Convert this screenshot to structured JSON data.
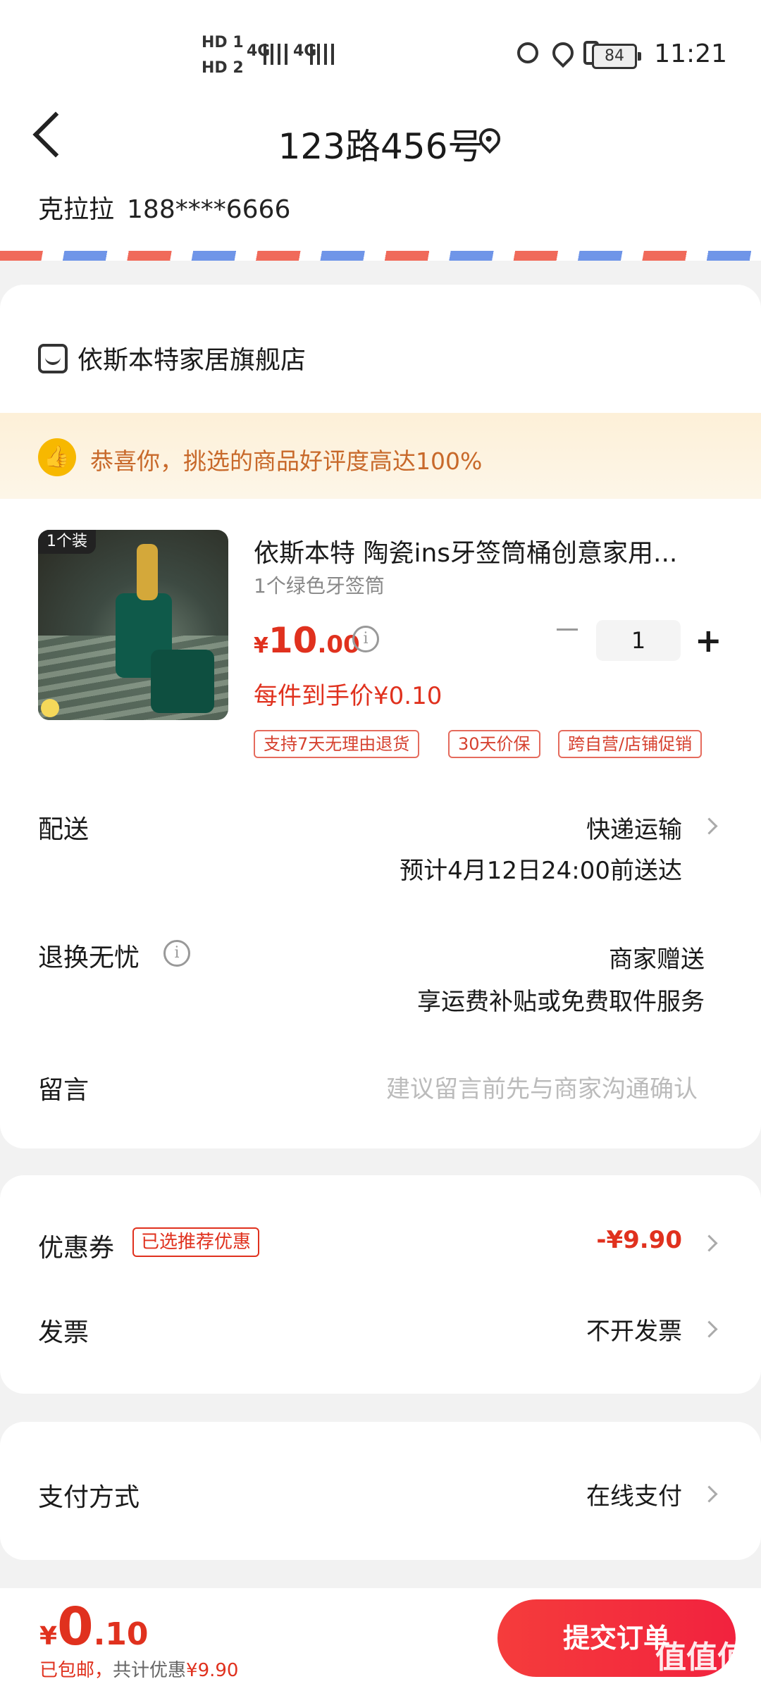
{
  "status_bar": {
    "hd1": "HD 1",
    "hd2": "HD 2",
    "net1": "4G",
    "net2": "4G",
    "battery": "84",
    "time": "11:21"
  },
  "address": {
    "title": "123路456号",
    "name": "克拉拉",
    "phone": "188****6666"
  },
  "shop": {
    "name": "依斯本特家居旗舰店"
  },
  "banner": {
    "text": "恭喜你，挑选的商品好评度高达100%"
  },
  "product": {
    "tag": "1个装",
    "title": "依斯本特 陶瓷ins牙签筒桶创意家用...",
    "spec": "1个绿色牙签筒",
    "price_symbol": "¥",
    "price_int": "10",
    "price_dec": ".00",
    "quantity": "1",
    "each_price": "每件到手价¥0.10",
    "services": [
      "支持7天无理由退货",
      "30天价保",
      "跨自营/店铺促销"
    ]
  },
  "delivery": {
    "label": "配送",
    "method": "快递运输",
    "eta": "预计4月12日24:00前送达"
  },
  "returns": {
    "label": "退换无忧",
    "value": "商家赠送",
    "detail": "享运费补贴或免费取件服务"
  },
  "message": {
    "label": "留言",
    "placeholder": "建议留言前先与商家沟通确认"
  },
  "coupon": {
    "label": "优惠券",
    "tag": "已选推荐优惠",
    "value": "-¥9.90"
  },
  "invoice": {
    "label": "发票",
    "value": "不开发票"
  },
  "payment": {
    "label": "支付方式",
    "value": "在线支付"
  },
  "footer": {
    "symbol": "¥",
    "total_int": "0",
    "total_dec": ".10",
    "shipping": "已包邮，",
    "discount_label": "共计优惠",
    "discount": "¥9.90",
    "submit": "提交订单",
    "watermark": "值值值"
  },
  "colors": {
    "accent": "#e0311e",
    "banner_text": "#c8692a",
    "submit_bg": "#f2223e"
  }
}
